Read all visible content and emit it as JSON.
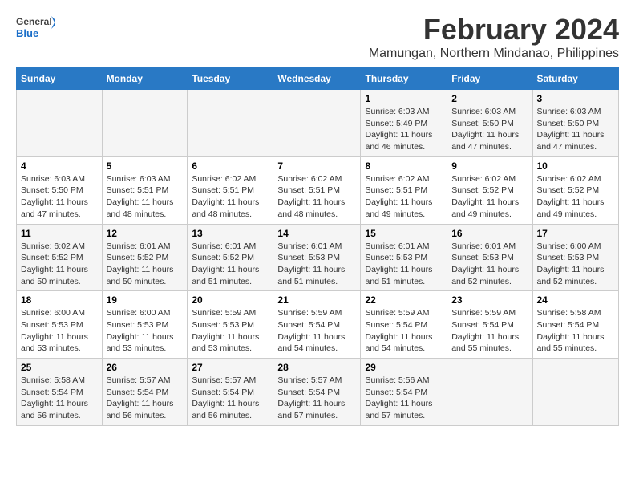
{
  "logo": {
    "line1": "General",
    "line2": "Blue"
  },
  "title": "February 2024",
  "subtitle": "Mamungan, Northern Mindanao, Philippines",
  "days_of_week": [
    "Sunday",
    "Monday",
    "Tuesday",
    "Wednesday",
    "Thursday",
    "Friday",
    "Saturday"
  ],
  "weeks": [
    [
      {
        "day": "",
        "sunrise": "",
        "sunset": "",
        "daylight": ""
      },
      {
        "day": "",
        "sunrise": "",
        "sunset": "",
        "daylight": ""
      },
      {
        "day": "",
        "sunrise": "",
        "sunset": "",
        "daylight": ""
      },
      {
        "day": "",
        "sunrise": "",
        "sunset": "",
        "daylight": ""
      },
      {
        "day": "1",
        "sunrise": "Sunrise: 6:03 AM",
        "sunset": "Sunset: 5:49 PM",
        "daylight": "Daylight: 11 hours and 46 minutes."
      },
      {
        "day": "2",
        "sunrise": "Sunrise: 6:03 AM",
        "sunset": "Sunset: 5:50 PM",
        "daylight": "Daylight: 11 hours and 47 minutes."
      },
      {
        "day": "3",
        "sunrise": "Sunrise: 6:03 AM",
        "sunset": "Sunset: 5:50 PM",
        "daylight": "Daylight: 11 hours and 47 minutes."
      }
    ],
    [
      {
        "day": "4",
        "sunrise": "Sunrise: 6:03 AM",
        "sunset": "Sunset: 5:50 PM",
        "daylight": "Daylight: 11 hours and 47 minutes."
      },
      {
        "day": "5",
        "sunrise": "Sunrise: 6:03 AM",
        "sunset": "Sunset: 5:51 PM",
        "daylight": "Daylight: 11 hours and 48 minutes."
      },
      {
        "day": "6",
        "sunrise": "Sunrise: 6:02 AM",
        "sunset": "Sunset: 5:51 PM",
        "daylight": "Daylight: 11 hours and 48 minutes."
      },
      {
        "day": "7",
        "sunrise": "Sunrise: 6:02 AM",
        "sunset": "Sunset: 5:51 PM",
        "daylight": "Daylight: 11 hours and 48 minutes."
      },
      {
        "day": "8",
        "sunrise": "Sunrise: 6:02 AM",
        "sunset": "Sunset: 5:51 PM",
        "daylight": "Daylight: 11 hours and 49 minutes."
      },
      {
        "day": "9",
        "sunrise": "Sunrise: 6:02 AM",
        "sunset": "Sunset: 5:52 PM",
        "daylight": "Daylight: 11 hours and 49 minutes."
      },
      {
        "day": "10",
        "sunrise": "Sunrise: 6:02 AM",
        "sunset": "Sunset: 5:52 PM",
        "daylight": "Daylight: 11 hours and 49 minutes."
      }
    ],
    [
      {
        "day": "11",
        "sunrise": "Sunrise: 6:02 AM",
        "sunset": "Sunset: 5:52 PM",
        "daylight": "Daylight: 11 hours and 50 minutes."
      },
      {
        "day": "12",
        "sunrise": "Sunrise: 6:01 AM",
        "sunset": "Sunset: 5:52 PM",
        "daylight": "Daylight: 11 hours and 50 minutes."
      },
      {
        "day": "13",
        "sunrise": "Sunrise: 6:01 AM",
        "sunset": "Sunset: 5:52 PM",
        "daylight": "Daylight: 11 hours and 51 minutes."
      },
      {
        "day": "14",
        "sunrise": "Sunrise: 6:01 AM",
        "sunset": "Sunset: 5:53 PM",
        "daylight": "Daylight: 11 hours and 51 minutes."
      },
      {
        "day": "15",
        "sunrise": "Sunrise: 6:01 AM",
        "sunset": "Sunset: 5:53 PM",
        "daylight": "Daylight: 11 hours and 51 minutes."
      },
      {
        "day": "16",
        "sunrise": "Sunrise: 6:01 AM",
        "sunset": "Sunset: 5:53 PM",
        "daylight": "Daylight: 11 hours and 52 minutes."
      },
      {
        "day": "17",
        "sunrise": "Sunrise: 6:00 AM",
        "sunset": "Sunset: 5:53 PM",
        "daylight": "Daylight: 11 hours and 52 minutes."
      }
    ],
    [
      {
        "day": "18",
        "sunrise": "Sunrise: 6:00 AM",
        "sunset": "Sunset: 5:53 PM",
        "daylight": "Daylight: 11 hours and 53 minutes."
      },
      {
        "day": "19",
        "sunrise": "Sunrise: 6:00 AM",
        "sunset": "Sunset: 5:53 PM",
        "daylight": "Daylight: 11 hours and 53 minutes."
      },
      {
        "day": "20",
        "sunrise": "Sunrise: 5:59 AM",
        "sunset": "Sunset: 5:53 PM",
        "daylight": "Daylight: 11 hours and 53 minutes."
      },
      {
        "day": "21",
        "sunrise": "Sunrise: 5:59 AM",
        "sunset": "Sunset: 5:54 PM",
        "daylight": "Daylight: 11 hours and 54 minutes."
      },
      {
        "day": "22",
        "sunrise": "Sunrise: 5:59 AM",
        "sunset": "Sunset: 5:54 PM",
        "daylight": "Daylight: 11 hours and 54 minutes."
      },
      {
        "day": "23",
        "sunrise": "Sunrise: 5:59 AM",
        "sunset": "Sunset: 5:54 PM",
        "daylight": "Daylight: 11 hours and 55 minutes."
      },
      {
        "day": "24",
        "sunrise": "Sunrise: 5:58 AM",
        "sunset": "Sunset: 5:54 PM",
        "daylight": "Daylight: 11 hours and 55 minutes."
      }
    ],
    [
      {
        "day": "25",
        "sunrise": "Sunrise: 5:58 AM",
        "sunset": "Sunset: 5:54 PM",
        "daylight": "Daylight: 11 hours and 56 minutes."
      },
      {
        "day": "26",
        "sunrise": "Sunrise: 5:57 AM",
        "sunset": "Sunset: 5:54 PM",
        "daylight": "Daylight: 11 hours and 56 minutes."
      },
      {
        "day": "27",
        "sunrise": "Sunrise: 5:57 AM",
        "sunset": "Sunset: 5:54 PM",
        "daylight": "Daylight: 11 hours and 56 minutes."
      },
      {
        "day": "28",
        "sunrise": "Sunrise: 5:57 AM",
        "sunset": "Sunset: 5:54 PM",
        "daylight": "Daylight: 11 hours and 57 minutes."
      },
      {
        "day": "29",
        "sunrise": "Sunrise: 5:56 AM",
        "sunset": "Sunset: 5:54 PM",
        "daylight": "Daylight: 11 hours and 57 minutes."
      },
      {
        "day": "",
        "sunrise": "",
        "sunset": "",
        "daylight": ""
      },
      {
        "day": "",
        "sunrise": "",
        "sunset": "",
        "daylight": ""
      }
    ]
  ]
}
